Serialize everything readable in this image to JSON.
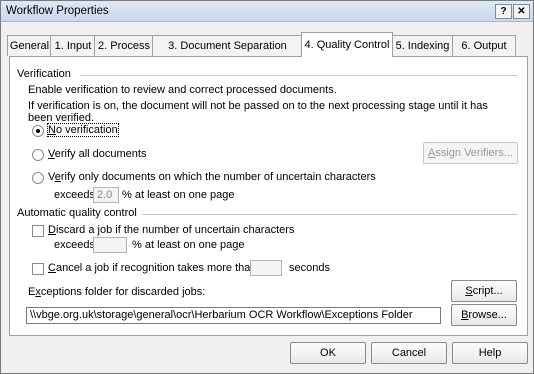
{
  "window": {
    "title": "Workflow Properties",
    "help_btn": "?",
    "close_btn": "✕"
  },
  "tabs": [
    "General",
    "1. Input",
    "2. Process",
    "3. Document Separation",
    "4. Quality Control",
    "5. Indexing",
    "6. Output"
  ],
  "active_tab_index": 4,
  "verification": {
    "heading": "Verification",
    "desc1": "Enable verification to review and correct processed documents.",
    "desc2a": "If verification is on, the document will not be passed on to the next processing stage until it has",
    "desc2b": "been verified.",
    "opt_none_pre": "",
    "opt_none_u": "N",
    "opt_none_post": "o verification",
    "opt_all_u": "V",
    "opt_all_post": "erify all documents",
    "opt_some_pre": "V",
    "opt_some_u": "e",
    "opt_some_post": "rify only documents on which the number of uncertain characters",
    "selected": "none",
    "exceeds_label": "exceeds",
    "exceeds_value": "2.0",
    "exceeds_suffix": "%  at least on one page",
    "assign_btn_u": "A",
    "assign_btn_post": "ssign Verifiers..."
  },
  "aqc": {
    "heading": "Automatic quality control",
    "discard_u": "D",
    "discard_post": "iscard a job if the number of uncertain characters",
    "discard_exceeds_label": "exceeds",
    "discard_exceeds_value": "",
    "discard_suffix": "% at least on one page",
    "cancel_u": "C",
    "cancel_post": "ancel a job if recognition takes more than",
    "cancel_value": "",
    "seconds_label": "seconds",
    "exceptions_pre": "E",
    "exceptions_u": "x",
    "exceptions_post": "ceptions folder for discarded jobs:",
    "script_btn_u": "S",
    "script_btn_post": "cript...",
    "folder_path": "\\\\vbge.org.uk\\storage\\general\\ocr\\Herbarium OCR Workflow\\Exceptions Folder",
    "browse_btn_u": "B",
    "browse_btn_post": "rowse..."
  },
  "footer": {
    "ok": "OK",
    "cancel": "Cancel",
    "help": "Help"
  }
}
